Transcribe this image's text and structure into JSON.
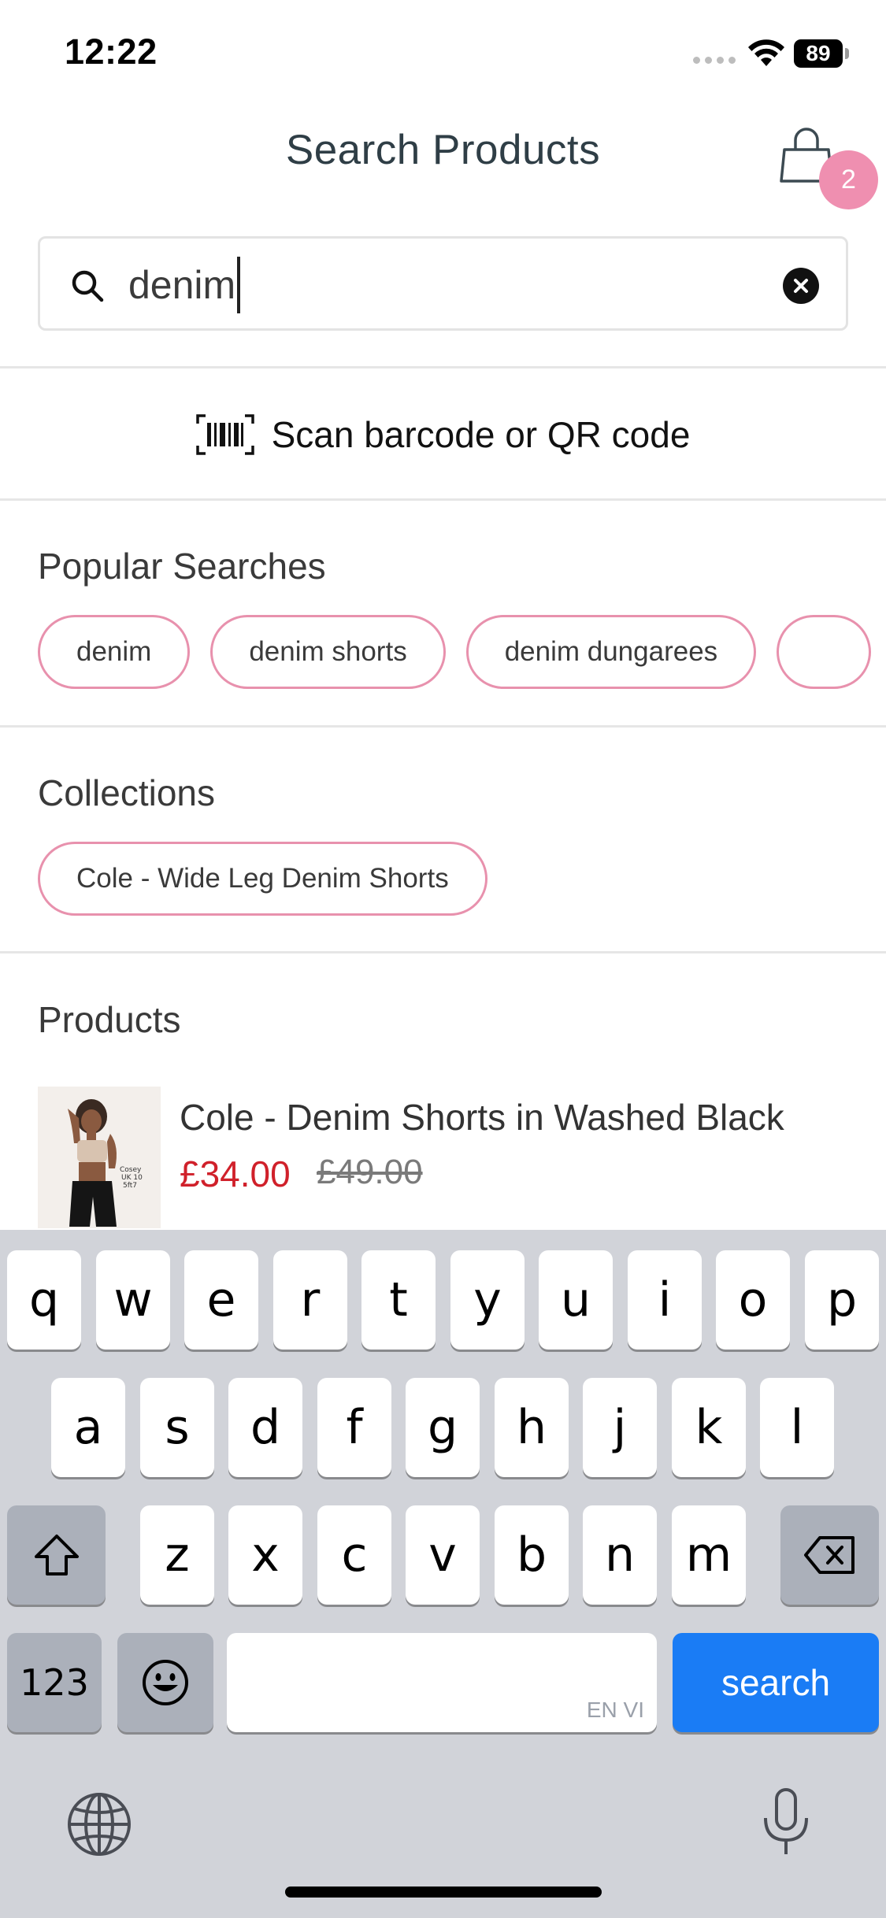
{
  "status_bar": {
    "time": "12:22",
    "battery": "89"
  },
  "header": {
    "title": "Search Products",
    "cart_count": "2"
  },
  "search": {
    "value": "denim"
  },
  "scan": {
    "label": "Scan barcode or QR code"
  },
  "popular": {
    "title": "Popular Searches",
    "items": [
      "denim",
      "denim shorts",
      "denim dungarees"
    ]
  },
  "collections": {
    "title": "Collections",
    "items": [
      "Cole - Wide Leg Denim Shorts"
    ]
  },
  "products": {
    "title": "Products",
    "items": [
      {
        "name": "Cole - Denim Shorts in Washed Black",
        "price": "£34.00",
        "original_price": "£49.00"
      }
    ]
  },
  "keyboard": {
    "row1": [
      "q",
      "w",
      "e",
      "r",
      "t",
      "y",
      "u",
      "i",
      "o",
      "p"
    ],
    "row2": [
      "a",
      "s",
      "d",
      "f",
      "g",
      "h",
      "j",
      "k",
      "l"
    ],
    "row3": [
      "z",
      "x",
      "c",
      "v",
      "b",
      "n",
      "m"
    ],
    "numbers_label": "123",
    "search_label": "search",
    "space_language": "EN VI"
  },
  "colors": {
    "accent_pink": "#e891ad",
    "badge_pink": "#ef8fb0",
    "sale_red": "#d0202a",
    "search_key_blue": "#1a7cf5"
  }
}
